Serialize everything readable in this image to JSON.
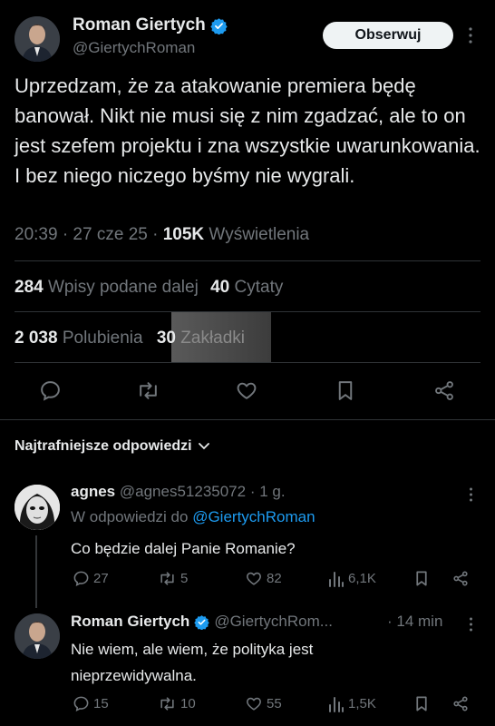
{
  "main_tweet": {
    "author_name": "Roman Giertych",
    "author_handle": "@GiertychRoman",
    "follow_label": "Obserwuj",
    "text": "Uprzedzam, że za atakowanie premiera będę banował. Nikt nie musi się z nim zgadzać, ale to on jest szefem projektu i zna wszystkie uwarunkowania. I bez niego niczego byśmy nie wygrali.",
    "time": "20:39 · 27 cze 25 ·",
    "views_count": "105K",
    "views_label": "Wyświetlenia",
    "reposts_count": "284",
    "reposts_label": "Wpisy podane dalej",
    "quotes_count": "40",
    "quotes_label": "Cytaty",
    "likes_count": "2 038",
    "likes_label": "Polubienia",
    "bookmarks_count": "30",
    "bookmarks_label": "Zakładki"
  },
  "replies_sort_label": "Najtrafniejsze odpowiedzi",
  "replies": [
    {
      "name": "agnes",
      "handle": "@agnes51235072",
      "time": "· 1 g.",
      "replying_prefix": "W odpowiedzi do",
      "replying_handle": "@GiertychRoman",
      "text": "Co będzie dalej Panie Romanie?",
      "replies": "27",
      "reposts": "5",
      "likes": "82",
      "views": "6,1K"
    },
    {
      "name": "Roman Giertych",
      "handle": "@GiertychRom...",
      "time": "· 14 min",
      "text": "Nie wiem, ale wiem, że polityka jest nieprzewidywalna.",
      "replies": "15",
      "reposts": "10",
      "likes": "55",
      "views": "1,5K"
    }
  ],
  "colors": {
    "background": "#000000",
    "text": "#e7e9ea",
    "muted": "#71767b",
    "link": "#1d9bf0",
    "divider": "#2f3336",
    "verified": "#1d9bf0"
  }
}
